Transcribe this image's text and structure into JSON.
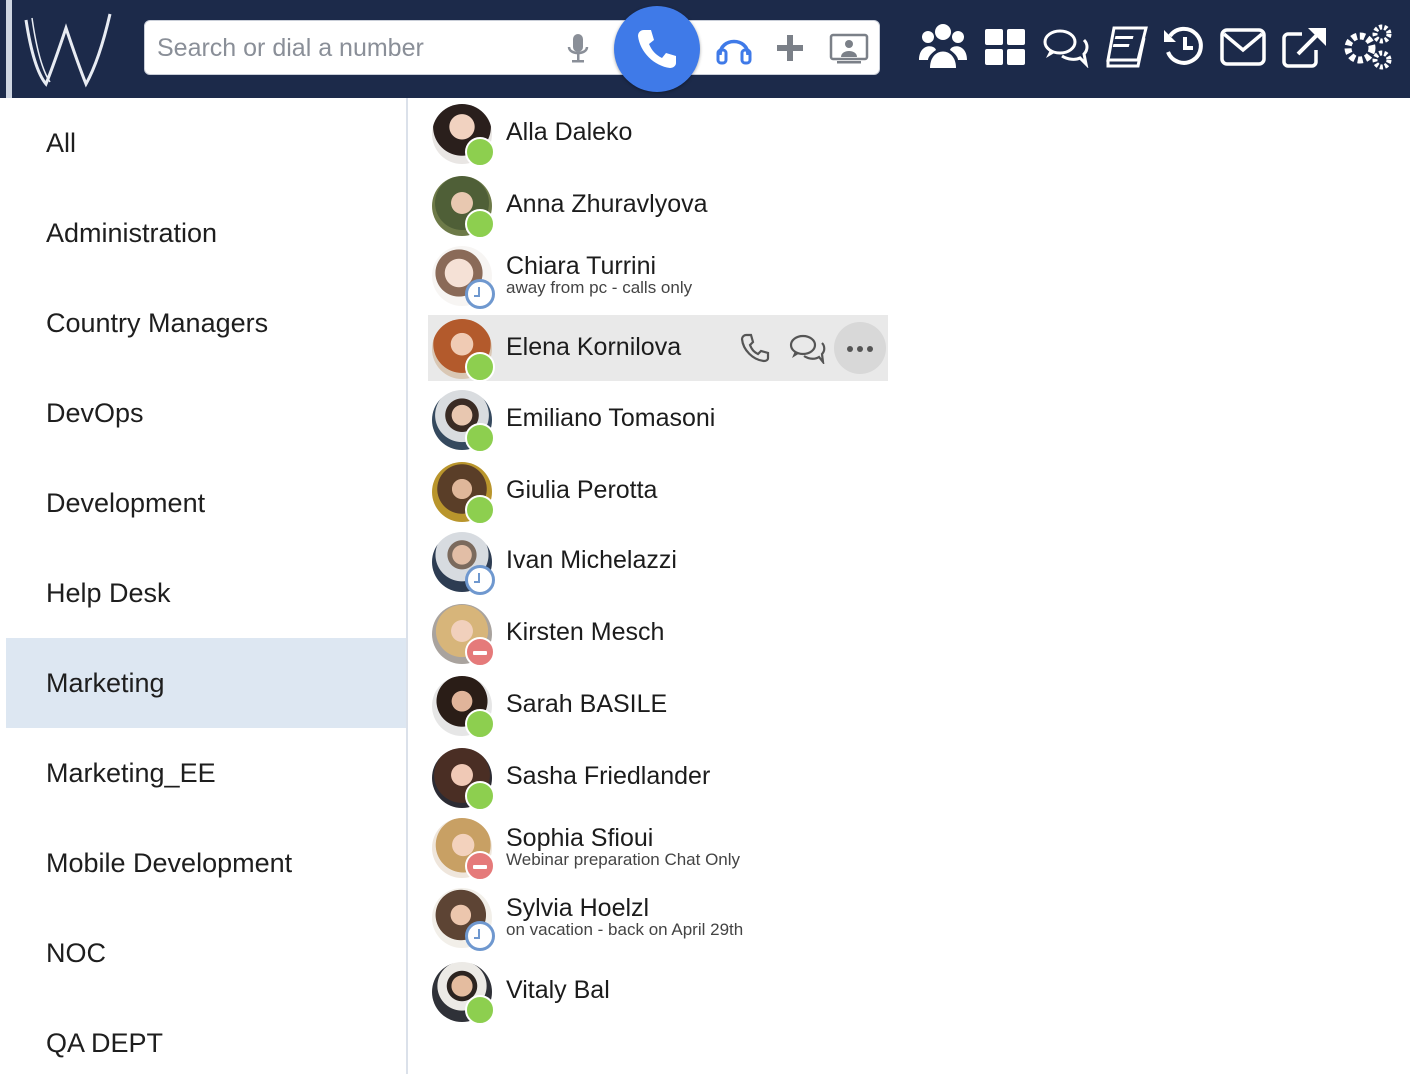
{
  "search": {
    "placeholder": "Search or dial a number"
  },
  "colors": {
    "topbar": "#1c2a4a",
    "accent": "#3f7ae8",
    "online": "#8dcf4f",
    "away": "#6f98cf",
    "dnd": "#e57a7a",
    "selected_group": "#dde7f2"
  },
  "toolbar_icons": [
    "microphone-icon",
    "phone-icon",
    "headset-icon",
    "plus-icon",
    "screen-share-icon"
  ],
  "nav_icons": [
    "contacts-icon",
    "dashboard-icon",
    "chat-icon",
    "phonebook-icon",
    "history-icon",
    "mail-icon",
    "external-link-icon",
    "settings-icon"
  ],
  "groups": [
    {
      "label": "All"
    },
    {
      "label": "Administration"
    },
    {
      "label": "Country Managers"
    },
    {
      "label": "DevOps"
    },
    {
      "label": "Development"
    },
    {
      "label": "Help Desk"
    },
    {
      "label": "Marketing",
      "selected": true
    },
    {
      "label": "Marketing_EE"
    },
    {
      "label": "Mobile Development"
    },
    {
      "label": "NOC"
    },
    {
      "label": "QA DEPT"
    }
  ],
  "contacts": [
    {
      "name": "Alla Daleko",
      "presence": "online",
      "status_text": ""
    },
    {
      "name": "Anna Zhuravlyova",
      "presence": "online",
      "status_text": ""
    },
    {
      "name": "Chiara Turrini",
      "presence": "away",
      "status_text": "away from pc - calls only"
    },
    {
      "name": "Elena Kornilova",
      "presence": "online",
      "status_text": "",
      "hovered": true
    },
    {
      "name": "Emiliano Tomasoni",
      "presence": "online",
      "status_text": ""
    },
    {
      "name": "Giulia Perotta",
      "presence": "online",
      "status_text": ""
    },
    {
      "name": "Ivan Michelazzi",
      "presence": "away",
      "status_text": ""
    },
    {
      "name": "Kirsten Mesch",
      "presence": "dnd",
      "status_text": ""
    },
    {
      "name": "Sarah BASILE",
      "presence": "online",
      "status_text": ""
    },
    {
      "name": "Sasha Friedlander",
      "presence": "online",
      "status_text": ""
    },
    {
      "name": "Sophia Sfioui",
      "presence": "dnd",
      "status_text": "Webinar preparation Chat Only"
    },
    {
      "name": "Sylvia Hoelzl",
      "presence": "away",
      "status_text": "on vacation - back on April 29th"
    },
    {
      "name": "Vitaly Bal",
      "presence": "online",
      "status_text": ""
    }
  ],
  "row_actions": [
    "call-icon",
    "chat-icon",
    "more-icon"
  ]
}
